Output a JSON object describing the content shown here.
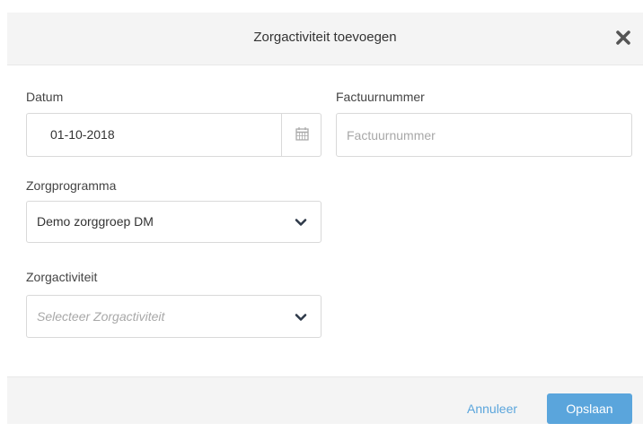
{
  "dialog": {
    "title": "Zorgactiviteit toevoegen",
    "close_icon": "close-icon"
  },
  "form": {
    "datum": {
      "label": "Datum",
      "value": "01-10-2018",
      "icon": "calendar-icon"
    },
    "factuurnummer": {
      "label": "Factuurnummer",
      "value": "",
      "placeholder": "Factuurnummer"
    },
    "zorgprogramma": {
      "label": "Zorgprogramma",
      "selected": "Demo zorggroep DM",
      "icon": "chevron-down-icon"
    },
    "zorgactiviteit": {
      "label": "Zorgactiviteit",
      "placeholder": "Selecteer Zorgactiviteit",
      "icon": "chevron-down-icon"
    }
  },
  "footer": {
    "cancel_label": "Annuleer",
    "save_label": "Opslaan"
  },
  "colors": {
    "accent": "#5aa5dc",
    "header_bg": "#f4f4f4",
    "border": "#d9d9d9"
  }
}
